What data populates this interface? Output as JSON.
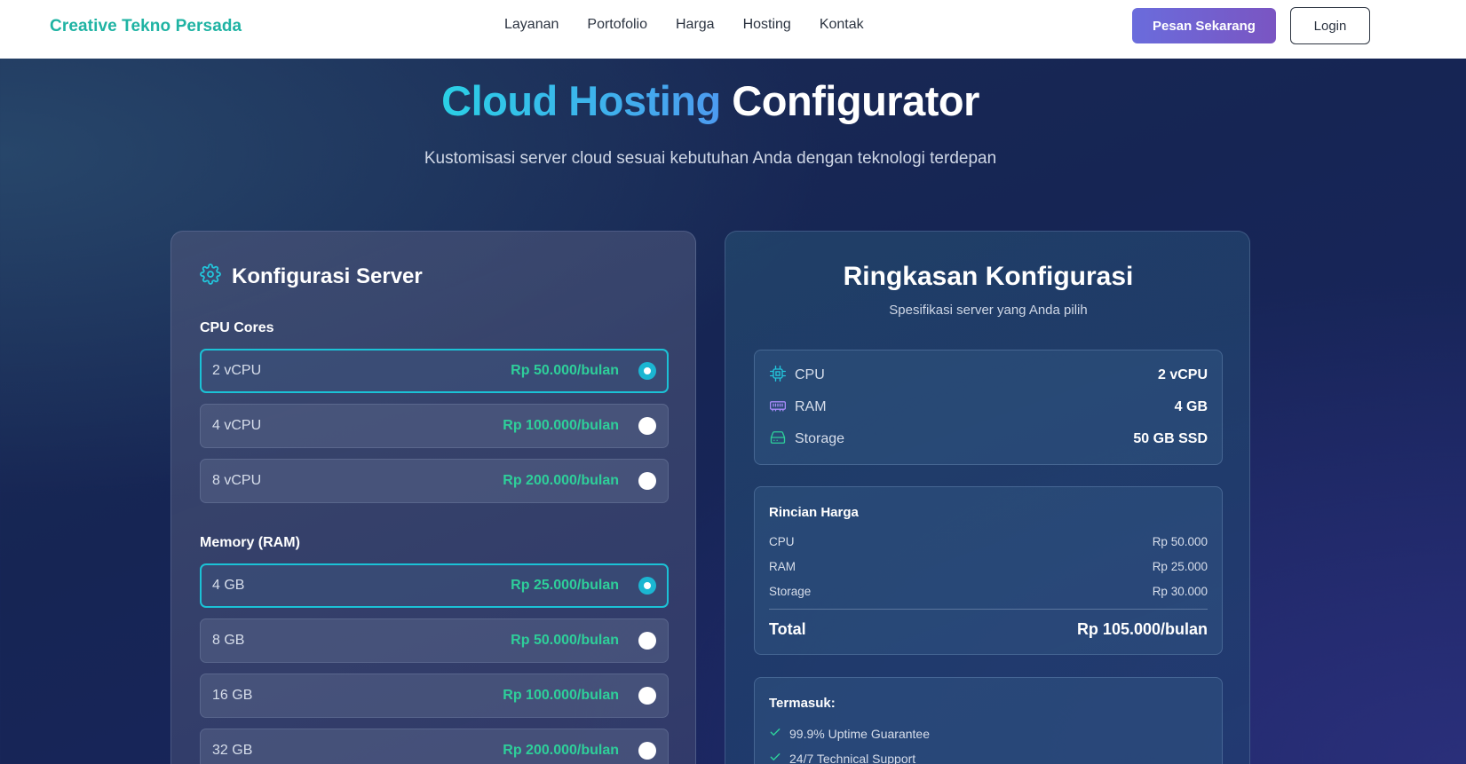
{
  "nav": {
    "brand": "Creative Tekno Persada",
    "links": [
      "Layanan",
      "Portofolio",
      "Harga",
      "Hosting",
      "Kontak"
    ],
    "order_label": "Pesan Sekarang",
    "login_label": "Login"
  },
  "hero": {
    "title_accent": "Cloud Hosting",
    "title_rest": "Configurator",
    "subtitle": "Kustomisasi server cloud sesuai kebutuhan Anda dengan teknologi terdepan"
  },
  "config": {
    "title": "Konfigurasi Server",
    "cpu": {
      "label": "CPU Cores",
      "options": [
        {
          "name": "2 vCPU",
          "price": "Rp 50.000/bulan",
          "selected": true
        },
        {
          "name": "4 vCPU",
          "price": "Rp 100.000/bulan",
          "selected": false
        },
        {
          "name": "8 vCPU",
          "price": "Rp 200.000/bulan",
          "selected": false
        }
      ]
    },
    "ram": {
      "label": "Memory (RAM)",
      "options": [
        {
          "name": "4 GB",
          "price": "Rp 25.000/bulan",
          "selected": true
        },
        {
          "name": "8 GB",
          "price": "Rp 50.000/bulan",
          "selected": false
        },
        {
          "name": "16 GB",
          "price": "Rp 100.000/bulan",
          "selected": false
        },
        {
          "name": "32 GB",
          "price": "Rp 200.000/bulan",
          "selected": false
        }
      ]
    }
  },
  "summary": {
    "title": "Ringkasan Konfigurasi",
    "subtitle": "Spesifikasi server yang Anda pilih",
    "specs": [
      {
        "icon": "cpu-icon",
        "label": "CPU",
        "value": "2 vCPU"
      },
      {
        "icon": "memory-icon",
        "label": "RAM",
        "value": "4 GB"
      },
      {
        "icon": "storage-icon",
        "label": "Storage",
        "value": "50 GB SSD"
      }
    ],
    "pricing": {
      "title": "Rincian Harga",
      "rows": [
        {
          "label": "CPU",
          "value": "Rp 50.000"
        },
        {
          "label": "RAM",
          "value": "Rp 25.000"
        },
        {
          "label": "Storage",
          "value": "Rp 30.000"
        }
      ],
      "total_label": "Total",
      "total_value": "Rp 105.000/bulan"
    },
    "includes": {
      "title": "Termasuk:",
      "items": [
        "99.9% Uptime Guarantee",
        "24/7 Technical Support"
      ]
    }
  },
  "colors": {
    "brand": "#1fb3a3",
    "accent_cyan": "#1bc2d6",
    "price_green": "#2ecf9a",
    "primary_button": "#6a6cdc"
  }
}
